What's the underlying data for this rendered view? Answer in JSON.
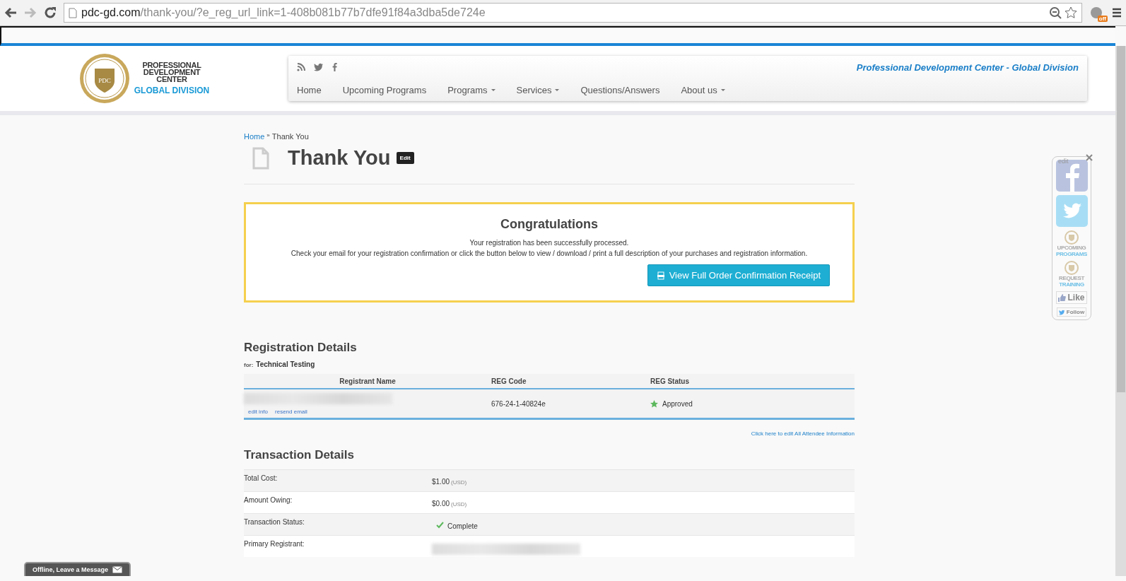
{
  "browser": {
    "url_host": "pdc-gd.com",
    "url_path": "/thank-you/?e_reg_url_link=1-408b081b77b7dfe91f84a3dba5de724e",
    "extension_badge": "off"
  },
  "header": {
    "logo_lines": [
      "PROFESSIONAL",
      "DEVELOPMENT",
      "CENTER"
    ],
    "logo_division": "GLOBAL DIVISION",
    "logo_seal": "PDC",
    "tagline": "Professional Development Center - Global Division",
    "nav": [
      {
        "label": "Home",
        "dropdown": false
      },
      {
        "label": "Upcoming Programs",
        "dropdown": false
      },
      {
        "label": "Programs",
        "dropdown": true
      },
      {
        "label": "Services",
        "dropdown": true
      },
      {
        "label": "Questions/Answers",
        "dropdown": false
      },
      {
        "label": "About us",
        "dropdown": true
      }
    ]
  },
  "breadcrumb": {
    "home": "Home",
    "separator": "»",
    "current": "Thank You"
  },
  "page_title": "Thank You",
  "edit_badge": "Edit",
  "notice": {
    "title": "Congratulations",
    "lines": [
      "Your registration has been successfully processed.",
      "Check your email for your registration confirmation or click the button below to view / download / print a full description of your purchases and registration information."
    ],
    "button": "View Full Order Confirmation Receipt"
  },
  "registration": {
    "title": "Registration Details",
    "for_label": "for:",
    "event": "Technical Testing",
    "columns": [
      "Registrant Name",
      "REG Code",
      "REG Status"
    ],
    "rows": [
      {
        "code": "676-24-1-40824e",
        "status": "Approved",
        "actions": [
          "edit info",
          "resend email"
        ]
      }
    ],
    "edit_all_link": "Click here to edit All Attendee Information"
  },
  "transaction": {
    "title": "Transaction Details",
    "rows": [
      {
        "kind": "money",
        "label": "Total Cost:",
        "value": "$1.00",
        "currency": "(USD)"
      },
      {
        "kind": "money",
        "label": "Amount Owing:",
        "value": "$0.00",
        "currency": "(USD)"
      },
      {
        "kind": "status",
        "label": "Transaction Status:",
        "value": "Complete"
      },
      {
        "kind": "hidden",
        "label": "Primary Registrant:"
      }
    ]
  },
  "share_widget": {
    "edit": "edit",
    "items": [
      {
        "kind": "facebook"
      },
      {
        "kind": "twitter"
      },
      {
        "kind": "badge",
        "line1": "UPCOMING",
        "line2": "PROGRAMS"
      },
      {
        "kind": "badge",
        "line1": "REQUEST",
        "line2": "TRAINING"
      },
      {
        "kind": "like",
        "label": "Like"
      },
      {
        "kind": "follow",
        "label": "Follow"
      }
    ]
  },
  "chat": {
    "label": "Offline, Leave a Message"
  }
}
